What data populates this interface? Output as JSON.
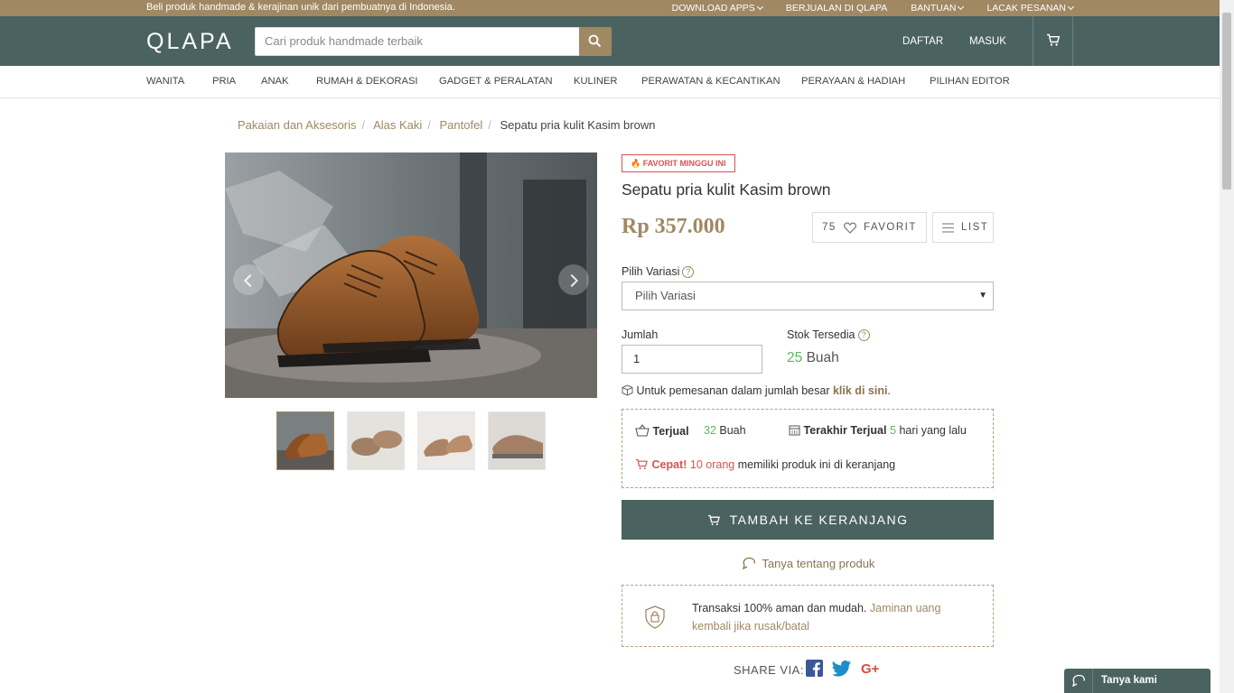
{
  "topbar": {
    "tagline": "Beli produk handmade & kerajinan unik dari pembuatnya di Indonesia.",
    "links": [
      "DOWNLOAD APPS",
      "BERJUALAN DI QLAPA",
      "BANTUAN",
      "LACAK PESANAN"
    ]
  },
  "header": {
    "logo": "QLAPA",
    "search_placeholder": "Cari produk handmade terbaik",
    "register": "DAFTAR",
    "login": "MASUK"
  },
  "categories": [
    "WANITA",
    "PRIA",
    "ANAK",
    "RUMAH & DEKORASI",
    "GADGET & PERALATAN",
    "KULINER",
    "PERAWATAN & KECANTIKAN",
    "PERAYAAN & HADIAH",
    "PILIHAN EDITOR"
  ],
  "breadcrumb": {
    "items": [
      "Pakaian dan Aksesoris",
      "Alas Kaki",
      "Pantofel"
    ],
    "current": "Sepatu pria kulit Kasim brown"
  },
  "product": {
    "badge": "FAVORIT MINGGU INI",
    "title": "Sepatu pria kulit Kasim brown",
    "price": "Rp 357.000",
    "favorite_count": "75",
    "favorite_label": "FAVORIT",
    "list_label": "LIST",
    "variation_label": "Pilih Variasi",
    "variation_selected": "Pilih Variasi",
    "qty_label": "Jumlah",
    "qty_value": "1",
    "stock_label": "Stok Tersedia",
    "stock_value": "25",
    "stock_unit": "Buah",
    "bulk_text": "Untuk pemesanan dalam jumlah besar",
    "bulk_link": "klik di sini",
    "sold_label": "Terjual",
    "sold_value": "32",
    "sold_unit": "Buah",
    "last_sold_label": "Terakhir Terjual",
    "last_sold_value": "5",
    "last_sold_unit": "hari yang lalu",
    "hurry_label": "Cepat!",
    "hurry_count": "10 orang",
    "hurry_text": "memiliki produk ini di keranjang",
    "add_to_cart": "TAMBAH KE KERANJANG",
    "ask": "Tanya tentang produk",
    "secure_text": "Transaksi 100% aman dan mudah.",
    "secure_link": "Jaminan uang kembali jika rusak/batal",
    "share_label": "SHARE VIA:"
  },
  "chat": {
    "label": "Tanya kami"
  },
  "colors": {
    "brand_gold": "#a08863",
    "brand_teal": "#4b6360",
    "alert_red": "#d9534f",
    "success_green": "#5cb85c"
  },
  "icons": [
    "search-icon",
    "cart-icon",
    "heart-icon",
    "list-icon",
    "help-icon",
    "box-icon",
    "basket-icon",
    "calendar-icon",
    "chat-icon",
    "shield-icon",
    "facebook-icon",
    "twitter-icon",
    "googleplus-icon"
  ]
}
